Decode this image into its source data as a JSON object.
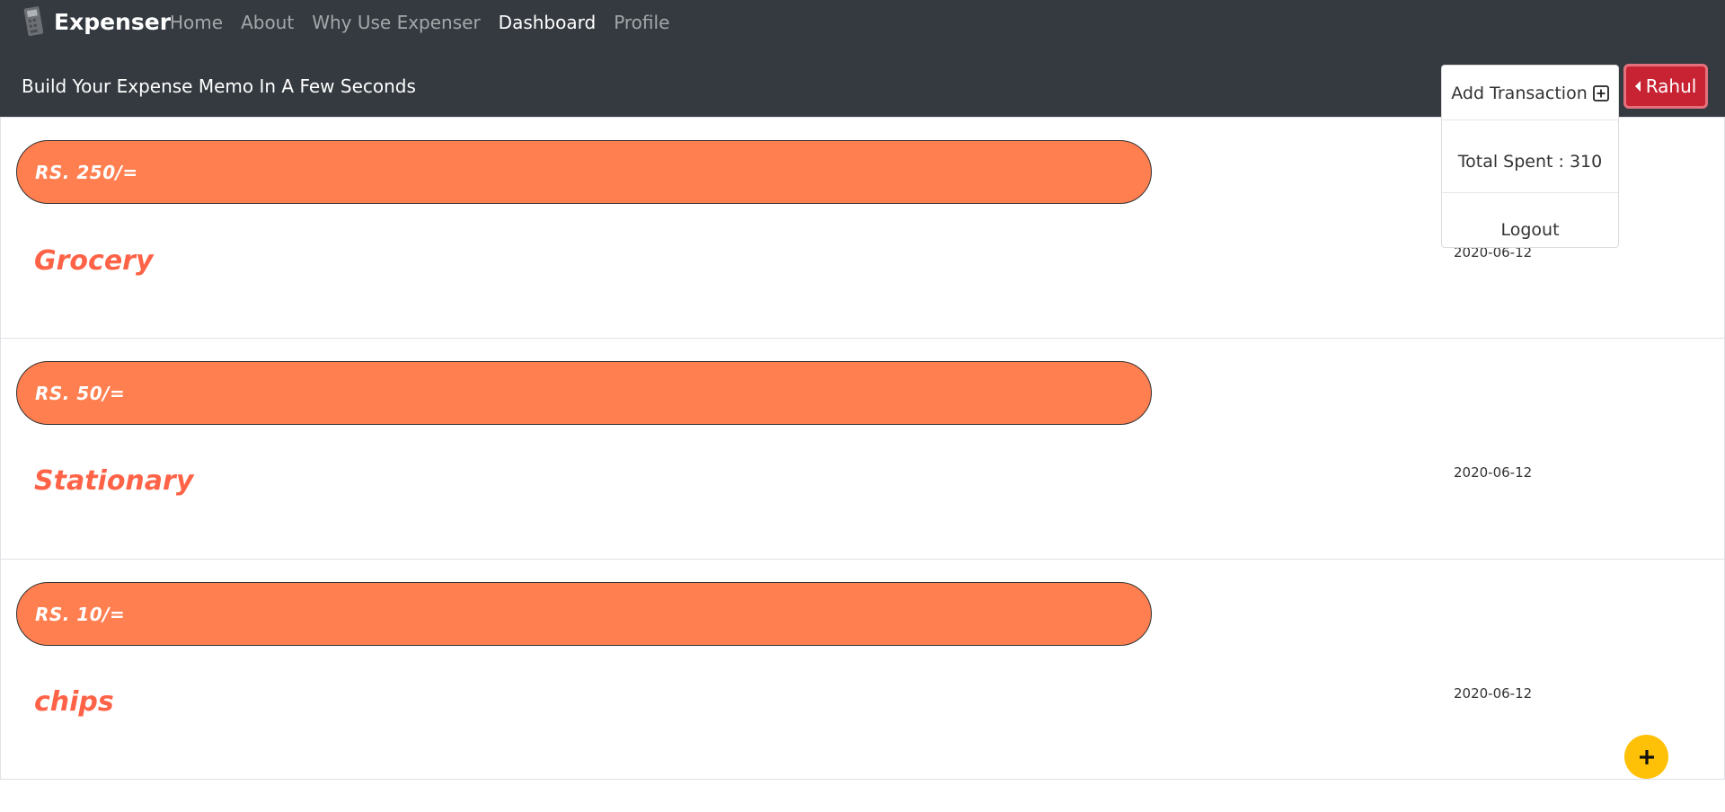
{
  "navbar": {
    "brand": "Expenser",
    "links": [
      {
        "label": "Home",
        "active": false
      },
      {
        "label": "About",
        "active": false
      },
      {
        "label": "Why Use Expenser",
        "active": false
      },
      {
        "label": "Dashboard",
        "active": true
      },
      {
        "label": "Profile",
        "active": false
      }
    ],
    "tagline": "Build Your Expense Memo In A Few Seconds",
    "user_button": "Rahul"
  },
  "dropdown": {
    "add_transaction": "Add Transaction",
    "total_spent": "Total Spent : 310",
    "logout": "Logout"
  },
  "transactions": [
    {
      "amount": "RS. 250/=",
      "category": "Grocery",
      "date": "2020-06-12"
    },
    {
      "amount": "RS. 50/=",
      "category": "Stationary",
      "date": "2020-06-12"
    },
    {
      "amount": "RS. 10/=",
      "category": "chips",
      "date": "2020-06-12"
    }
  ],
  "colors": {
    "navbar_bg": "#343a40",
    "pill": "#ff7f50",
    "category_text": "#ff6347",
    "user_button": "#c82333",
    "fab": "#ffc107"
  },
  "icons": {
    "brand": "calculator-icon",
    "add_transaction": "plus-square-icon",
    "user_caret": "caret-left-icon",
    "fab": "plus-icon"
  }
}
